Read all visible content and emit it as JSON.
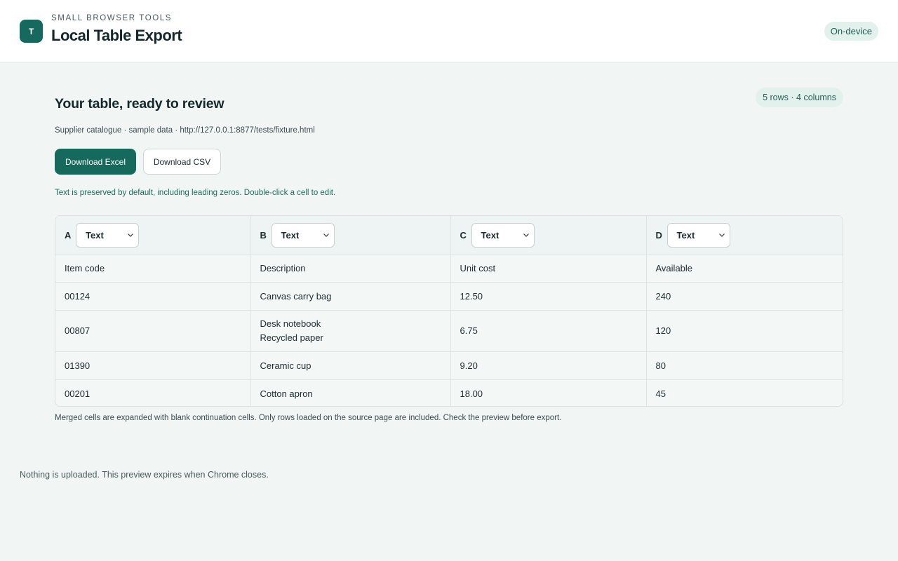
{
  "header": {
    "logo_letter": "T",
    "kicker": "SMALL BROWSER TOOLS",
    "title": "Local Table Export",
    "status": "On-device"
  },
  "summary": {
    "title": "Your table, ready to review",
    "count": "5 rows · 4 columns",
    "source": "Supplier catalogue · sample data · http://127.0.0.1:8877/tests/fixture.html"
  },
  "actions": {
    "download_excel": "Download Excel",
    "download_csv": "Download CSV"
  },
  "hint": "Text is preserved by default, including leading zeros. Double-click a cell to edit.",
  "table": {
    "columns": [
      {
        "letter": "A",
        "type": "Text",
        "header": "Item code"
      },
      {
        "letter": "B",
        "type": "Text",
        "header": "Description"
      },
      {
        "letter": "C",
        "type": "Text",
        "header": "Unit cost"
      },
      {
        "letter": "D",
        "type": "Text",
        "header": "Available"
      }
    ],
    "rows": [
      [
        "00124",
        "Canvas carry bag",
        "12.50",
        "240"
      ],
      [
        "00807",
        "Desk notebook",
        "6.75",
        "120"
      ],
      [
        "01390",
        "Ceramic cup",
        "9.20",
        "80"
      ],
      [
        "00201",
        "Cotton apron",
        "18.00",
        "45"
      ]
    ],
    "row1_extra_line": "Recycled paper"
  },
  "footnote": "Merged cells are expanded with blank continuation cells. Only rows loaded on the source page are included. Check the preview before export.",
  "bottom_note": "Nothing is uploaded. This preview expires when Chrome closes.",
  "colors": {
    "accent": "#166a5d",
    "pill_bg": "#e2f1ec",
    "page_bg": "#f1f6f5"
  }
}
